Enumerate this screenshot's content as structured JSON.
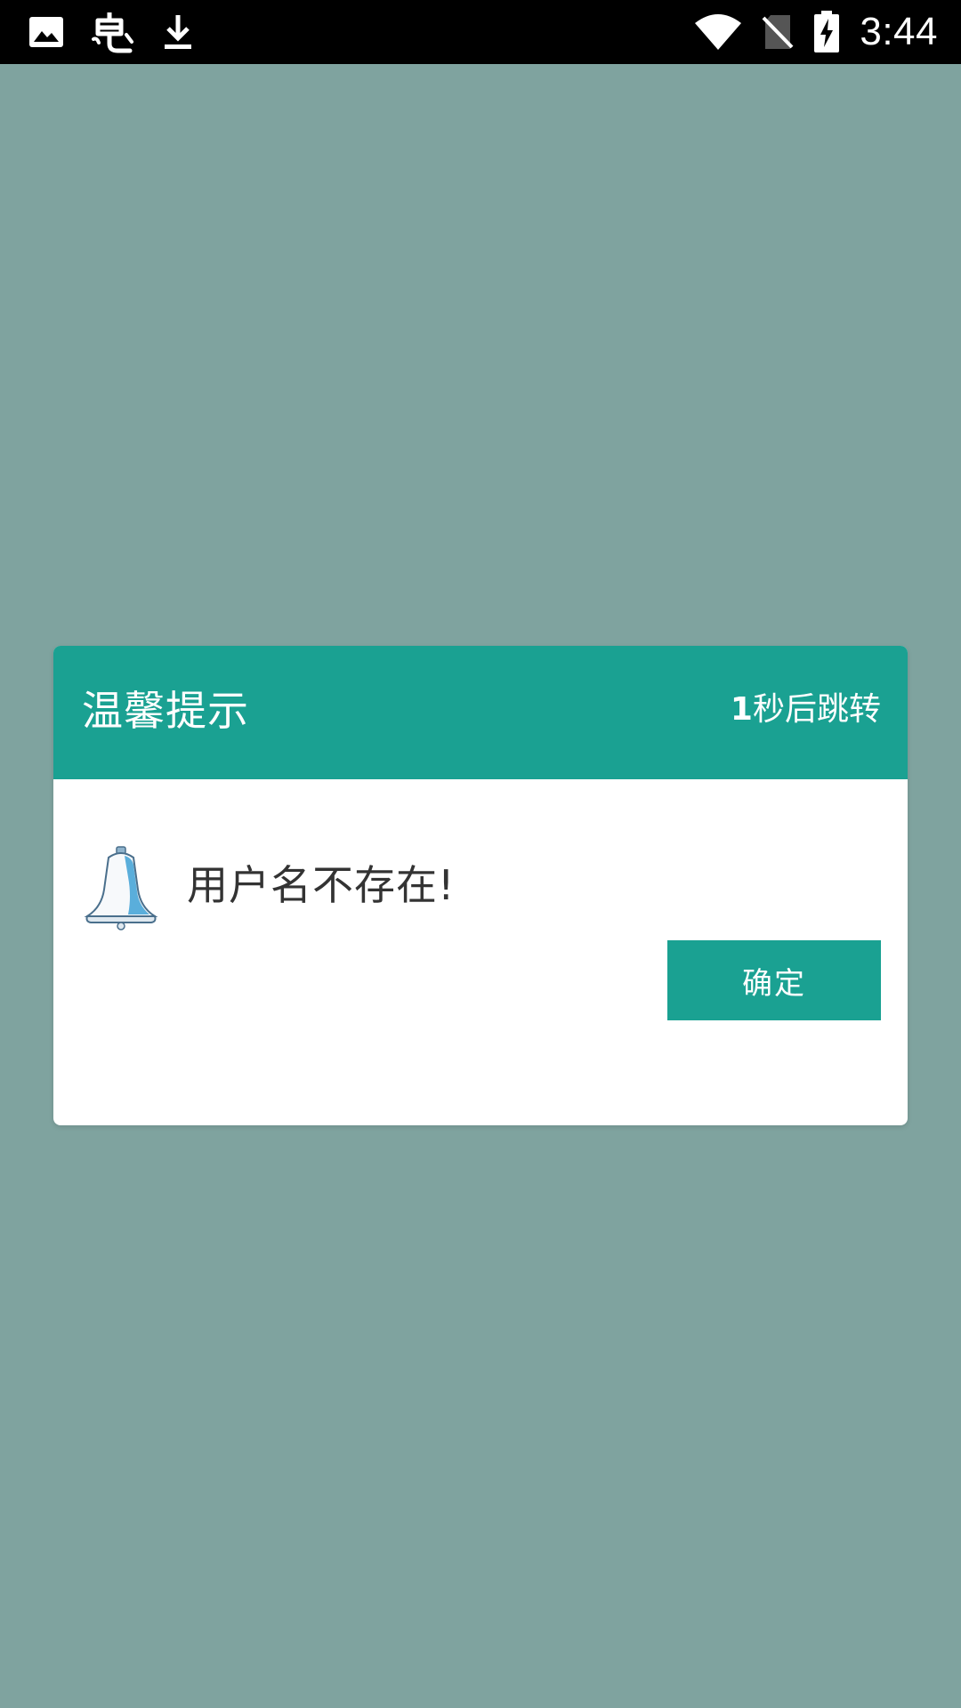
{
  "status_bar": {
    "time": "3:44",
    "left_icons": [
      "image-icon",
      "bug-app-icon",
      "download-icon"
    ],
    "right_icons": [
      "wifi-icon",
      "no-sim-icon",
      "battery-charging-icon"
    ]
  },
  "dialog": {
    "title": "温馨提示",
    "countdown": {
      "count": "1",
      "suffix": "秒后跳转"
    },
    "message": "用户名不存在!",
    "icon": "bell-icon",
    "confirm_label": "确定"
  },
  "colors": {
    "overlay_background": "#7fa39f",
    "accent": "#1aa192",
    "status_bar": "#000000",
    "message_text": "#333333"
  }
}
